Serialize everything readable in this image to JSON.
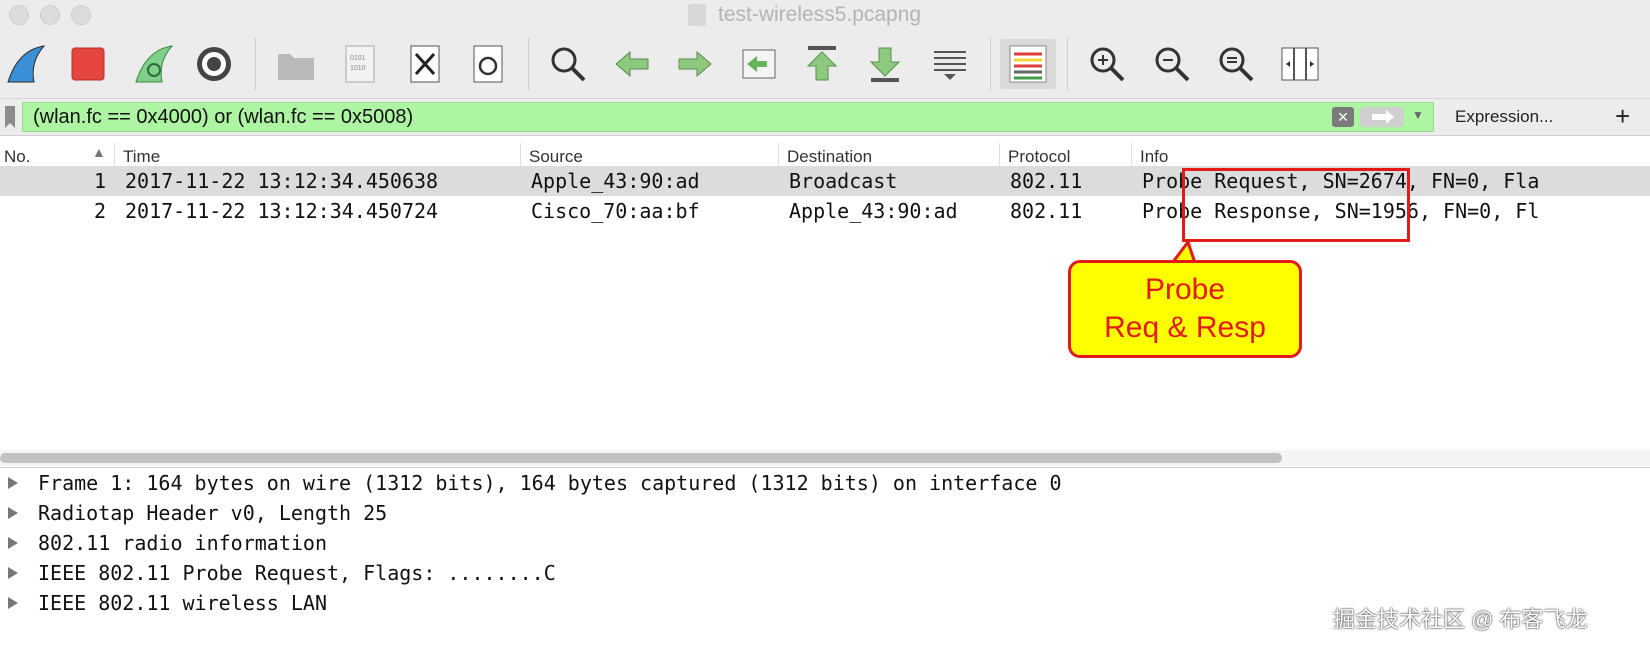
{
  "window": {
    "title": "test-wireless5.pcapng"
  },
  "filter": {
    "value": "(wlan.fc == 0x4000) or (wlan.fc == 0x5008)",
    "expression_label": "Expression...",
    "add_label": "+"
  },
  "columns": {
    "no": "No.",
    "time": "Time",
    "source": "Source",
    "destination": "Destination",
    "protocol": "Protocol",
    "info": "Info"
  },
  "packets": [
    {
      "no": "1",
      "time": "2017-11-22 13:12:34.450638",
      "source": "Apple_43:90:ad",
      "destination": "Broadcast",
      "protocol": "802.11",
      "info": "Probe Request, SN=2674, FN=0, Fla"
    },
    {
      "no": "2",
      "time": "2017-11-22 13:12:34.450724",
      "source": "Cisco_70:aa:bf",
      "destination": "Apple_43:90:ad",
      "protocol": "802.11",
      "info": "Probe Response, SN=1956, FN=0, Fl"
    }
  ],
  "details": [
    "Frame 1: 164 bytes on wire (1312 bits), 164 bytes captured (1312 bits) on interface 0",
    "Radiotap Header v0, Length 25",
    "802.11 radio information",
    "IEEE 802.11 Probe Request, Flags: ........C",
    "IEEE 802.11 wireless LAN"
  ],
  "annotation": {
    "line1": "Probe",
    "line2": "Req & Resp"
  },
  "watermark": "掘金技术社区 @ 布客飞龙",
  "colors": {
    "filter_bg": "#aef5a3",
    "selected_row": "#dcdcdc",
    "annotation_red": "#e11a1a",
    "callout_yellow": "#ffff00"
  }
}
